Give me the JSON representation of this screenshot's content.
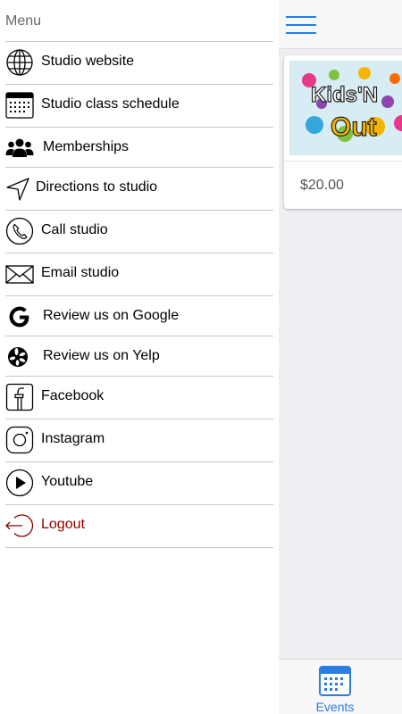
{
  "menu": {
    "title": "Menu",
    "items": [
      {
        "label": "Studio website",
        "icon": "globe-icon"
      },
      {
        "label": "Studio class schedule",
        "icon": "calendar-icon"
      },
      {
        "label": "Memberships",
        "icon": "people-icon"
      },
      {
        "label": "Directions to studio",
        "icon": "navigation-arrow-icon"
      },
      {
        "label": "Call studio",
        "icon": "phone-icon"
      },
      {
        "label": "Email studio",
        "icon": "envelope-icon"
      },
      {
        "label": "Review us on Google",
        "icon": "google-icon"
      },
      {
        "label": "Review us on Yelp",
        "icon": "yelp-icon"
      },
      {
        "label": "Facebook",
        "icon": "facebook-icon"
      },
      {
        "label": "Instagram",
        "icon": "instagram-icon"
      },
      {
        "label": "Youtube",
        "icon": "youtube-play-icon"
      },
      {
        "label": "Logout",
        "icon": "logout-icon",
        "color": "#8b0000"
      }
    ]
  },
  "main": {
    "event_card": {
      "image_text_line1": "Kids'N",
      "image_text_line2": "Out",
      "price": "$20.00"
    }
  },
  "tabbar": {
    "events_label": "Events"
  },
  "colors": {
    "accent": "#2a7de1",
    "logout": "#8b0000",
    "background": "#eeeff3"
  }
}
